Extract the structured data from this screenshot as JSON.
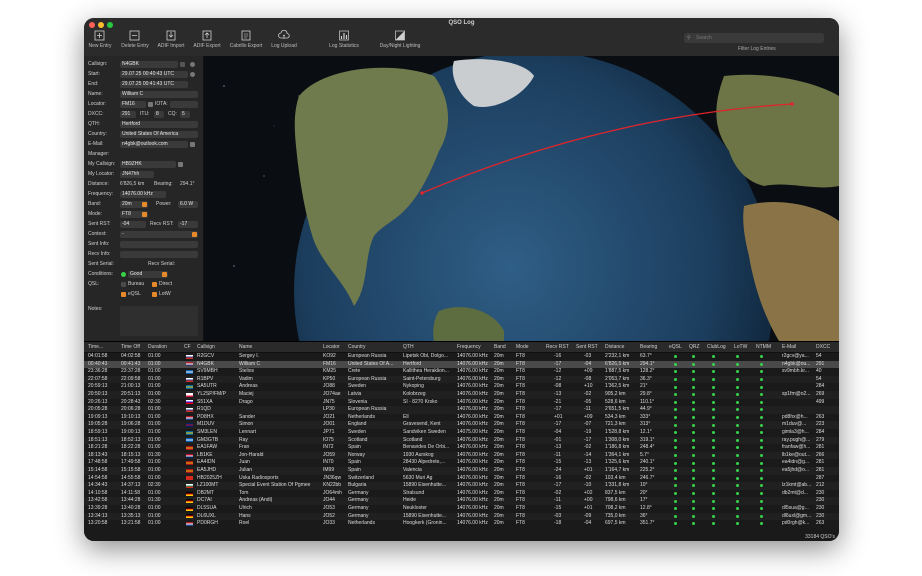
{
  "window": {
    "title": "QSO Log"
  },
  "toolbar": [
    {
      "label": "New Entry",
      "icon": "new-entry-icon"
    },
    {
      "label": "Delete Entry",
      "icon": "delete-entry-icon"
    },
    {
      "label": "ADIF Import",
      "icon": "adif-import-icon"
    },
    {
      "label": "ADIF Export",
      "icon": "adif-export-icon"
    },
    {
      "label": "Cabrillo Export",
      "icon": "cabrillo-export-icon"
    },
    {
      "label": "Log Upload",
      "icon": "cloud-upload-icon"
    },
    {
      "label": "Log Statistics",
      "icon": "bar-chart-icon"
    },
    {
      "label": "Day/Night Lighting",
      "icon": "day-night-icon"
    }
  ],
  "search": {
    "placeholder": "Search",
    "filter_label": "Filter Log Entries"
  },
  "form": {
    "callsign_label": "Callsign:",
    "callsign": "N4GBK",
    "start_label": "Start:",
    "start": "29.07.25 00:40:43 UTC",
    "end_label": "End:",
    "end": "29.07.25 00:41:43 UTC",
    "name_label": "Name:",
    "name": "William C",
    "locator_label": "Locator:",
    "locator": "FM16",
    "iota_label": "IOTA:",
    "dxcc_label": "DXCC:",
    "dxcc": "291",
    "itu_label": "ITU:",
    "itu": "8",
    "cq_label": "CQ:",
    "cq": "5",
    "qth_label": "QTH:",
    "qth": "Hertford",
    "country_label": "Country:",
    "country": "United States Of America",
    "email_label": "E-Mail:",
    "email": "n4gbk@outlook.com",
    "manager_label": "Manager:",
    "my_callsign_label": "My Callsign:",
    "my_callsign": "HB9ZHK",
    "my_locator_label": "My Locator:",
    "my_locator": "JN47hh",
    "distance_label": "Distance:",
    "distance": "6'826,5 km",
    "bearing_label": "Bearing:",
    "bearing": "294.1°",
    "frequency_label": "Frequency:",
    "frequency": "14076.00 kHz",
    "band_label": "Band:",
    "band": "20m",
    "power_label": "Power:",
    "power": "6.0 W",
    "mode_label": "Mode:",
    "mode": "FT8",
    "sent_rst_label": "Sent RST:",
    "sent_rst": "-04",
    "recv_rst_label": "Recv RST:",
    "recv_rst": "-17",
    "contest_label": "Contest:",
    "contest": "-",
    "sent_info_label": "Sent Info:",
    "recv_info_label": "Recv Info:",
    "sent_serial_label": "Sent Serial:",
    "recv_serial_label": "Recv Serial:",
    "conditions_label": "Conditions:",
    "conditions": "Good",
    "qsl_label": "QSL:",
    "bureau": "Bureau",
    "direct": "Direct",
    "eqsl": "eQSL",
    "lotw": "LotW",
    "notes_label": "Notes:"
  },
  "table": {
    "headers": [
      "Time...",
      "Time Off",
      "Duration",
      "CF",
      "Callsign",
      "Name",
      "Locator",
      "Country",
      "QTH",
      "Frequency",
      "Band",
      "Mode",
      "Recv RST",
      "Sent RST",
      "Distance",
      "Bearing",
      "eQSL",
      "QRZ",
      "ClubLog",
      "LoTW",
      "NTMM",
      "E-Mail",
      "DXCC"
    ],
    "rows": [
      {
        "time": "04:01:58",
        "off": "04:02:58",
        "dur": "01:00",
        "call": "R2GCV",
        "name": "Sergey I.",
        "loc": "KO92",
        "country": "European Russia",
        "qth": "Lipetsk Obl, Dolgo...",
        "freq": "14076.00 kHz",
        "band": "20m",
        "mode": "FT8",
        "recv": "-16",
        "sent": "-03",
        "dist": "2'232,1 km",
        "bear": "63.7°",
        "email": "r2gcv@ya...",
        "dxcc": "54",
        "flag": "ru"
      },
      {
        "time": "00:40:43",
        "off": "00:41:43",
        "dur": "01:00",
        "call": "N4GBK",
        "name": "William C",
        "loc": "FM16",
        "country": "United States Of A...",
        "qth": "Hertford",
        "freq": "14076.00 kHz",
        "band": "20m",
        "mode": "FT8",
        "recv": "-17",
        "sent": "-04",
        "dist": "6'826,5 km",
        "bear": "294.1°",
        "email": "n4gbk@ou...",
        "dxcc": "291",
        "flag": "us",
        "selected": true
      },
      {
        "time": "23:36:28",
        "off": "23:37:28",
        "dur": "01:00",
        "call": "SV9MBH",
        "name": "Stelios",
        "loc": "KM25",
        "country": "Crete",
        "qth": "Kallithea Heraklion...",
        "freq": "14076.00 kHz",
        "band": "20m",
        "mode": "FT8",
        "recv": "-12",
        "sent": "+09",
        "dist": "1'887,5 km",
        "bear": "128.2°",
        "email": "sv9mbh.kr...",
        "dxcc": "40",
        "flag": "gr"
      },
      {
        "time": "22:07:58",
        "off": "22:09:58",
        "dur": "01:00",
        "call": "R1BPV",
        "name": "Vadim",
        "loc": "KP50",
        "country": "European Russia",
        "qth": "Saint-Petersburg",
        "freq": "14076.00 kHz",
        "band": "20m",
        "mode": "FT8",
        "recv": "-12",
        "sent": "-08",
        "dist": "2'053,7 km",
        "bear": "36.3°",
        "email": "",
        "dxcc": "54",
        "flag": "ru"
      },
      {
        "time": "20:59:13",
        "off": "21:00:13",
        "dur": "01:00",
        "call": "SA5UTR",
        "name": "Andreas",
        "loc": "JO88",
        "country": "Sweden",
        "qth": "Nykoping",
        "freq": "14076.00 kHz",
        "band": "20m",
        "mode": "FT8",
        "recv": "-08",
        "sent": "+10",
        "dist": "1'362,5 km",
        "bear": "21°",
        "email": "",
        "dxcc": "284",
        "flag": "se"
      },
      {
        "time": "20:50:13",
        "off": "20:51:13",
        "dur": "01:00",
        "call": "YL2SP/FM/P",
        "name": "Maciej",
        "loc": "JO74ae",
        "country": "Latvia",
        "qth": "Kolobrzeg",
        "freq": "14076.00 kHz",
        "band": "20m",
        "mode": "FT8",
        "recv": "-13",
        "sent": "-02",
        "dist": "905,2 km",
        "bear": "29.8°",
        "email": "sp1fm@o2...",
        "dxcc": "269",
        "flag": "pl"
      },
      {
        "time": "20:26:13",
        "off": "20:28:43",
        "dur": "02:30",
        "call": "S51XA",
        "name": "Drago",
        "loc": "JN75",
        "country": "Slovenia",
        "qth": "SI - 8270 Krsko",
        "freq": "14076.00 kHz",
        "band": "20m",
        "mode": "FT8",
        "recv": "-21",
        "sent": "-05",
        "dist": "528,6 km",
        "bear": "110.1°",
        "email": "",
        "dxcc": "499",
        "flag": "si"
      },
      {
        "time": "20:05:28",
        "off": "20:06:28",
        "dur": "01:00",
        "call": "R1QD",
        "name": "",
        "loc": "LP30",
        "country": "European Russia",
        "qth": "",
        "freq": "14076.00 kHz",
        "band": "20m",
        "mode": "FT8",
        "recv": "-17",
        "sent": "-11",
        "dist": "2'651,5 km",
        "bear": "44.9°",
        "email": "",
        "dxcc": "",
        "flag": "ru"
      },
      {
        "time": "19:09:13",
        "off": "19:10:13",
        "dur": "01:00",
        "call": "PD8HX",
        "name": "Sander",
        "loc": "JO21",
        "country": "Netherlands",
        "qth": "Ell",
        "freq": "14076.00 kHz",
        "band": "20m",
        "mode": "FT8",
        "recv": "+01",
        "sent": "+09",
        "dist": "534,3 km",
        "bear": "333°",
        "email": "pd8hx@h...",
        "dxcc": "263",
        "flag": "nl"
      },
      {
        "time": "19:05:28",
        "off": "19:06:28",
        "dur": "01:00",
        "call": "M1DUV",
        "name": "Simon",
        "loc": "JO01",
        "country": "England",
        "qth": "Gravesend, Kent",
        "freq": "14076.00 kHz",
        "band": "20m",
        "mode": "FT8",
        "recv": "-17",
        "sent": "-07",
        "dist": "721,3 km",
        "bear": "313°",
        "email": "m1duv@...",
        "dxcc": "223",
        "flag": "gb"
      },
      {
        "time": "18:59:13",
        "off": "19:00:13",
        "dur": "01:00",
        "call": "SM3LEN",
        "name": "Lennart",
        "loc": "JP71",
        "country": "Sweden",
        "qth": "Sandviken Sweden",
        "freq": "14075.00 kHz",
        "band": "20m",
        "mode": "FT8",
        "recv": "-04",
        "sent": "-19",
        "dist": "1'528,8 km",
        "bear": "12.1°",
        "email": "gimla3@h...",
        "dxcc": "284",
        "flag": "se"
      },
      {
        "time": "18:51:13",
        "off": "18:52:13",
        "dur": "01:00",
        "call": "GM3GTB",
        "name": "Ray",
        "loc": "IO75",
        "country": "Scotland",
        "qth": "Scotland",
        "freq": "14076.00 kHz",
        "band": "20m",
        "mode": "FT8",
        "recv": "-01",
        "sent": "-17",
        "dist": "1'308,0 km",
        "bear": "319.1°",
        "email": "ray.pugh@...",
        "dxcc": "279",
        "flag": "sc"
      },
      {
        "time": "18:21:28",
        "off": "18:22:28",
        "dur": "01:00",
        "call": "EA1FAW",
        "name": "Fran",
        "loc": "IN72",
        "country": "Spain",
        "qth": "Benavides De Orbi...",
        "freq": "14076.00 kHz",
        "band": "20m",
        "mode": "FT8",
        "recv": "-13",
        "sent": "-02",
        "dist": "1'186,8 km",
        "bear": "248.4°",
        "email": "franfaw@h...",
        "dxcc": "281",
        "flag": "es"
      },
      {
        "time": "18:13:43",
        "off": "18:15:13",
        "dur": "01:30",
        "call": "LB1KE",
        "name": "Jon-Harald",
        "loc": "JO59",
        "country": "Norway",
        "qth": "1930 Aurskog",
        "freq": "14076.00 kHz",
        "band": "20m",
        "mode": "FT8",
        "recv": "-11",
        "sent": "-14",
        "dist": "1'364,1 km",
        "bear": "5.7°",
        "email": "lb1ke@out...",
        "dxcc": "266",
        "flag": "no"
      },
      {
        "time": "17:48:58",
        "off": "17:49:58",
        "dur": "01:00",
        "call": "EA4IDN",
        "name": "Juan",
        "loc": "IN70",
        "country": "Spain",
        "qth": "28430 Alpedrete,...",
        "freq": "14076.00 kHz",
        "band": "20m",
        "mode": "FT8",
        "recv": "-15",
        "sent": "-13",
        "dist": "1'325,6 km",
        "bear": "240.1°",
        "email": "ea4idn@g...",
        "dxcc": "281",
        "flag": "es"
      },
      {
        "time": "15:14:58",
        "off": "15:15:58",
        "dur": "01:00",
        "call": "EA5JHD",
        "name": "Julian",
        "loc": "IM99",
        "country": "Spain",
        "qth": "Valencia",
        "freq": "14076.00 kHz",
        "band": "20m",
        "mode": "FT8",
        "recv": "-24",
        "sent": "+01",
        "dist": "1'164,7 km",
        "bear": "225.2°",
        "email": "ea5jhd@o...",
        "dxcc": "281",
        "flag": "es"
      },
      {
        "time": "14:54:58",
        "off": "14:55:58",
        "dur": "01:00",
        "call": "HB2025ZH",
        "name": "Uska Radiosports",
        "loc": "JN36qw",
        "country": "Switzerland",
        "qth": "5630 Muri Ag",
        "freq": "14076.00 kHz",
        "band": "20m",
        "mode": "FT8",
        "recv": "-16",
        "sent": "-02",
        "dist": "103,4 km",
        "bear": "246.7°",
        "email": "",
        "dxcc": "287",
        "flag": "ch"
      },
      {
        "time": "14:34:43",
        "off": "14:37:13",
        "dur": "02:30",
        "call": "LZ100MT",
        "name": "Special Event Station Of Pgmee",
        "loc": "KN22bb",
        "country": "Bulgaria",
        "qth": "15890 Eisenhutte...",
        "freq": "14076.00 kHz",
        "band": "20m",
        "mode": "FT8",
        "recv": "-17",
        "sent": "-10",
        "dist": "1'331,8 km",
        "bear": "10°",
        "email": "lz1kmt@ab...",
        "dxcc": "212",
        "flag": "bg"
      },
      {
        "time": "14:10:58",
        "off": "14:11:58",
        "dur": "01:00",
        "call": "DB2MT",
        "name": "Tom",
        "loc": "JO64mh",
        "country": "Germany",
        "qth": "Stralsund",
        "freq": "14076.00 kHz",
        "band": "20m",
        "mode": "FT8",
        "recv": "-02",
        "sent": "+02",
        "dist": "837,5 km",
        "bear": "20°",
        "email": "db2mt@d...",
        "dxcc": "230",
        "flag": "de"
      },
      {
        "time": "13:42:58",
        "off": "13:44:28",
        "dur": "01:30",
        "call": "DC7AI",
        "name": "Andreas (Andi)",
        "loc": "JO44",
        "country": "Germany",
        "qth": "Heide",
        "freq": "14076.00 kHz",
        "band": "20m",
        "mode": "FT8",
        "recv": "-11",
        "sent": "+00",
        "dist": "798,6 km",
        "bear": "17°",
        "email": "",
        "dxcc": "230",
        "flag": "de"
      },
      {
        "time": "13:39:28",
        "off": "13:40:28",
        "dur": "01:00",
        "call": "DL5SUA",
        "name": "Ulrich",
        "loc": "JO53",
        "country": "Germany",
        "qth": "Neukloster",
        "freq": "14076.00 kHz",
        "band": "20m",
        "mode": "FT8",
        "recv": "-15",
        "sent": "+01",
        "dist": "708,2 km",
        "bear": "12.8°",
        "email": "dl5sua@g...",
        "dxcc": "230",
        "flag": "de"
      },
      {
        "time": "13:34:13",
        "off": "13:35:13",
        "dur": "01:00",
        "call": "DL6UXL",
        "name": "Hans",
        "loc": "JO52",
        "country": "Germany",
        "qth": "15890 Eisenhutte...",
        "freq": "14076.00 kHz",
        "band": "20m",
        "mode": "FT8",
        "recv": "-03",
        "sent": "-09",
        "dist": "735,0 km",
        "bear": "36°",
        "email": "dl6uxl@gm...",
        "dxcc": "230",
        "flag": "de"
      },
      {
        "time": "13:20:58",
        "off": "13:21:58",
        "dur": "01:00",
        "call": "PD0RGH",
        "name": "Roel",
        "loc": "JO33",
        "country": "Netherlands",
        "qth": "Hoogkerk (Gronin...",
        "freq": "14076.00 kHz",
        "band": "20m",
        "mode": "FT8",
        "recv": "-18",
        "sent": "-04",
        "dist": "697,5 km",
        "bear": "351.7°",
        "email": "pd0rgh@k...",
        "dxcc": "263",
        "flag": "nl"
      }
    ],
    "status": "33184 QSO's"
  }
}
